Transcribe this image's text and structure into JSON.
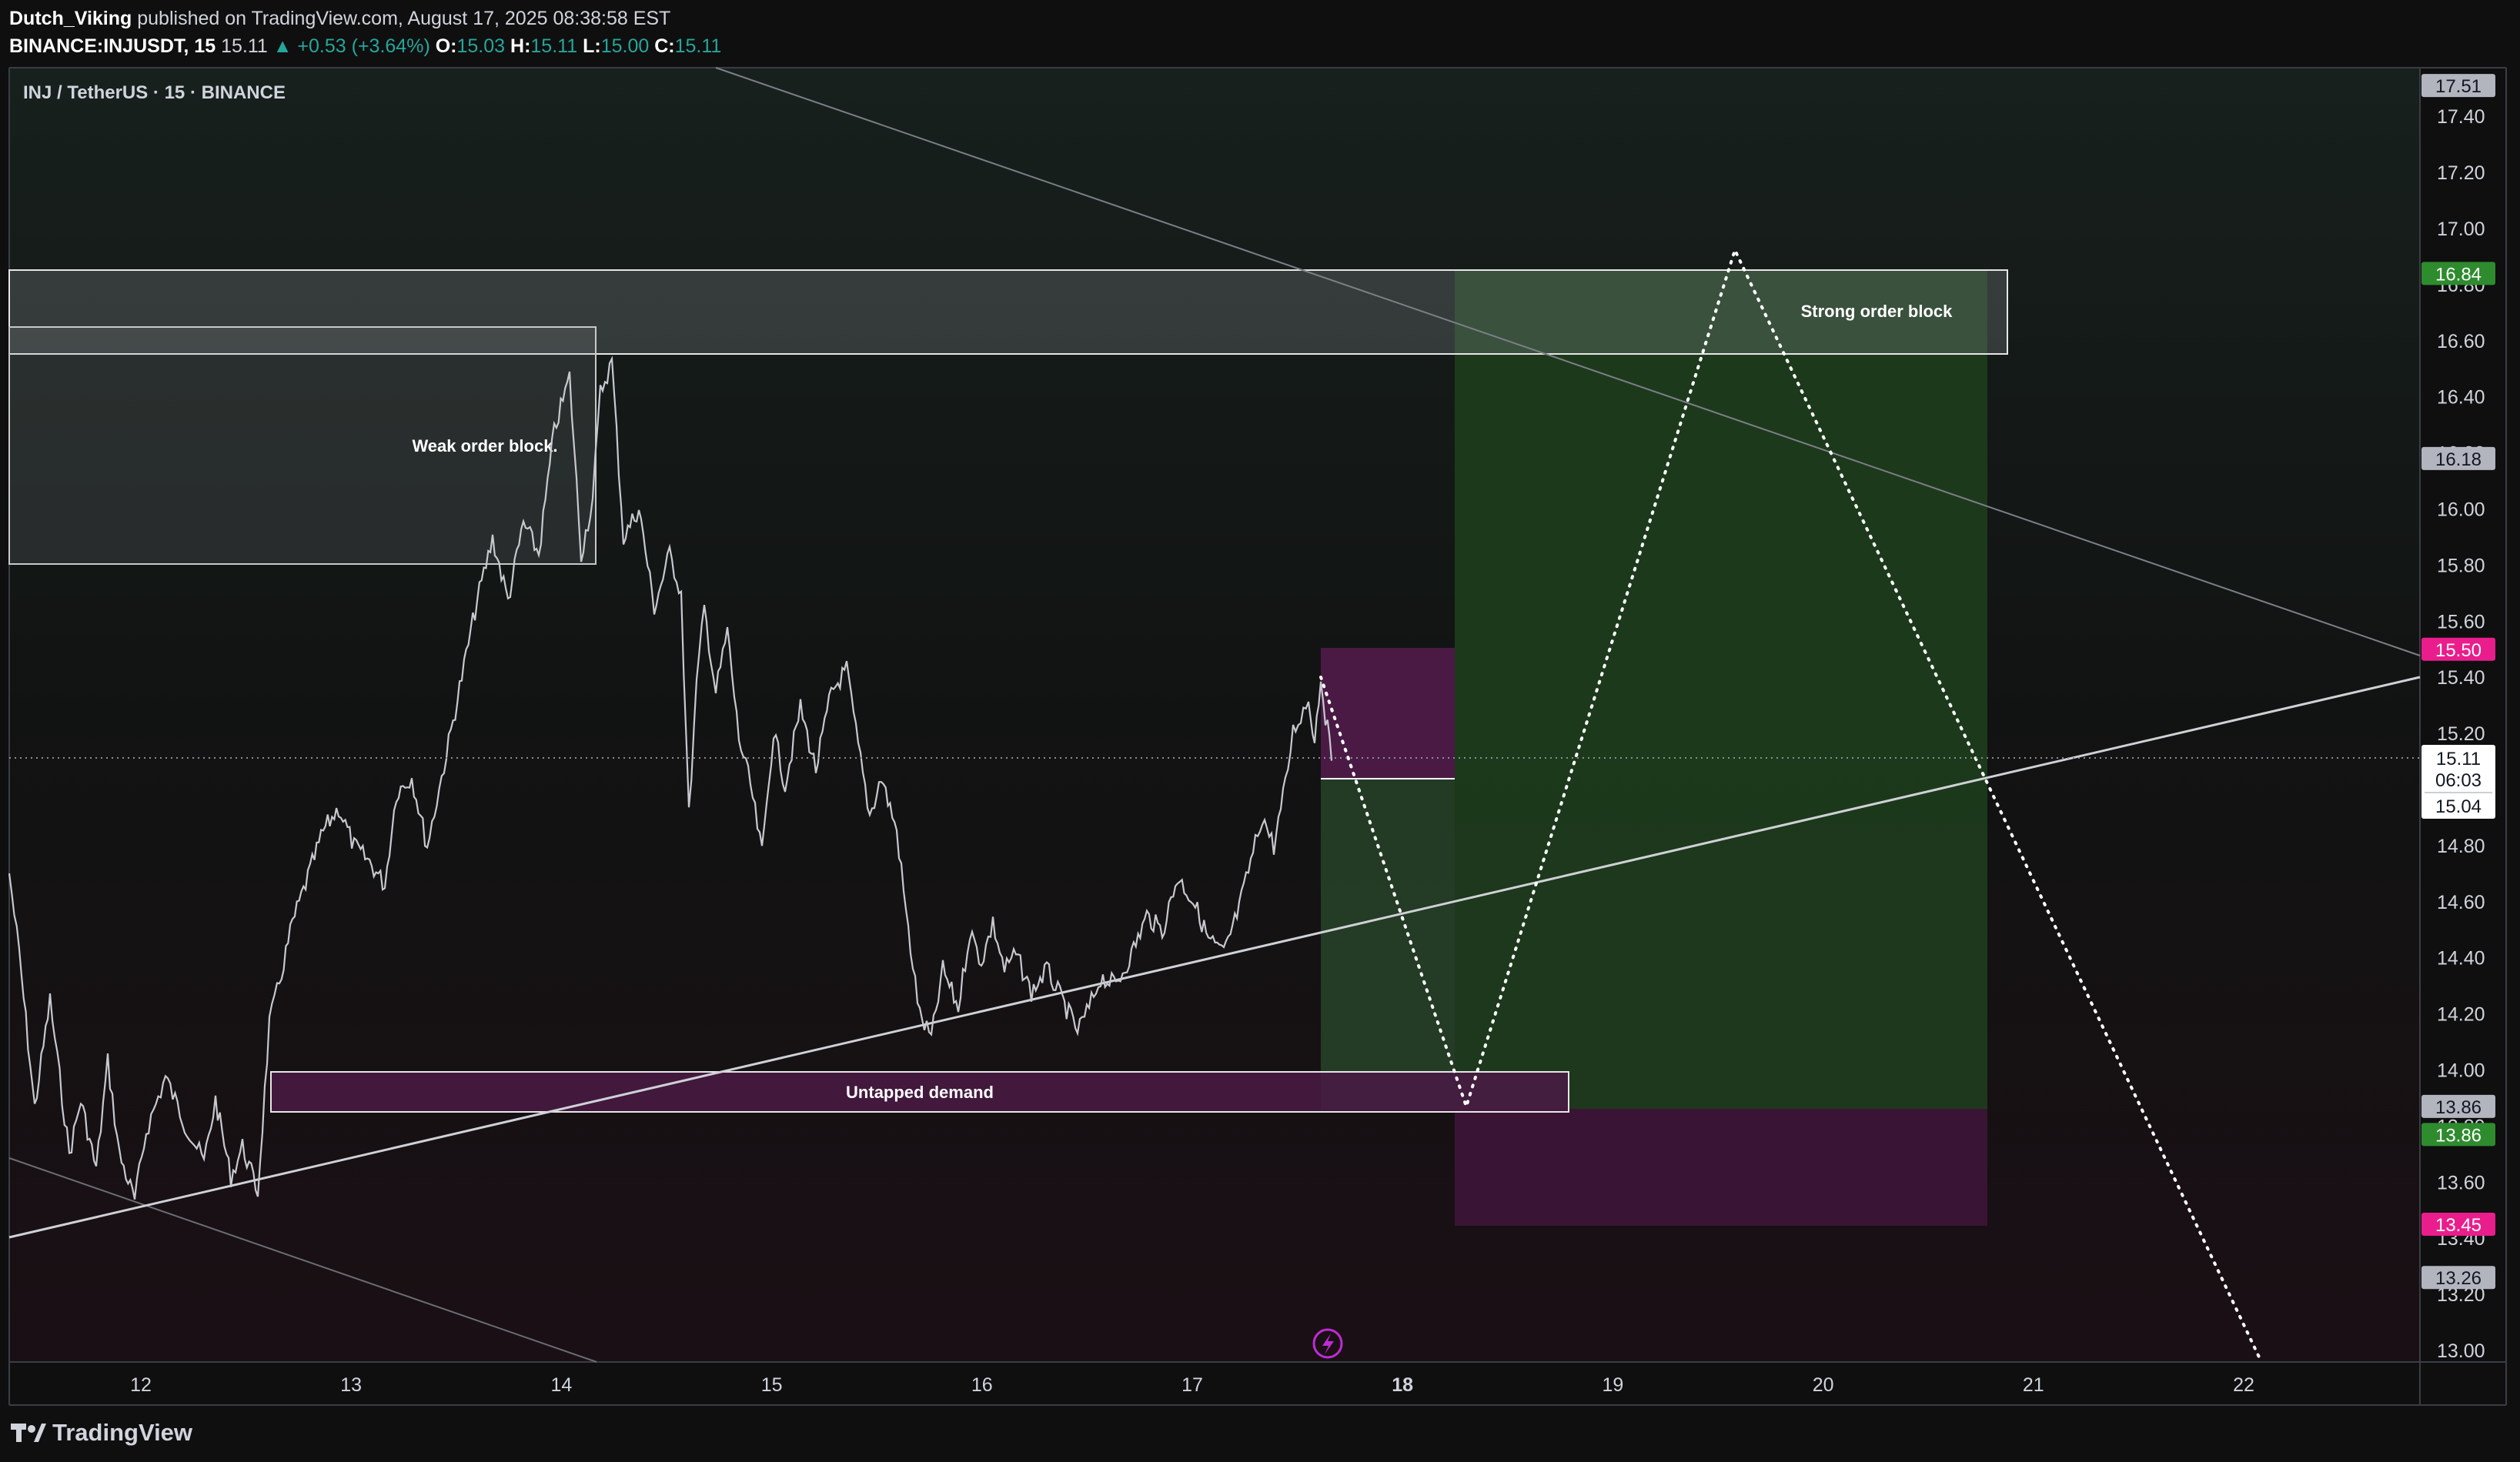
{
  "header": {
    "author": "Dutch_Viking",
    "published_text": "published on TradingView.com, August 17, 2025 08:38:58 EST",
    "symbol": "BINANCE:INJUSDT, 15",
    "last": "15.11",
    "change": "▲ +0.53 (+3.64%)",
    "o_label": "O:",
    "o": "15.03",
    "h_label": "H:",
    "h": "15.11",
    "l_label": "L:",
    "l": "15.00",
    "c_label": "C:",
    "c": "15.11"
  },
  "chart_title": "INJ / TetherUS · 15 · BINANCE",
  "colors": {
    "up": "#26a69a",
    "pink": "#e91e8c",
    "green_tag": "#2e8b2e",
    "grey_tag": "#b2b5be",
    "profit_zone": "#1e3b1c",
    "loss_zone": "#3a1434"
  },
  "price_axis": {
    "min": 13.0,
    "max": 17.6,
    "ticks": [
      "17.40",
      "17.20",
      "17.00",
      "16.80",
      "16.60",
      "16.40",
      "16.20",
      "16.00",
      "15.80",
      "15.60",
      "15.40",
      "15.20",
      "15.00",
      "14.80",
      "14.60",
      "14.40",
      "14.20",
      "14.00",
      "13.80",
      "13.60",
      "13.40",
      "13.20",
      "13.00"
    ],
    "tags": [
      {
        "value": "17.51",
        "price": 17.51,
        "style": "grey"
      },
      {
        "value": "16.84",
        "price": 16.84,
        "style": "green"
      },
      {
        "value": "16.18",
        "price": 16.18,
        "style": "grey"
      },
      {
        "value": "15.50",
        "price": 15.5,
        "style": "pink"
      },
      {
        "value": "13.86",
        "price": 13.87,
        "style": "grey"
      },
      {
        "value": "13.86",
        "price": 13.77,
        "style": "green"
      },
      {
        "value": "13.45",
        "price": 13.45,
        "style": "pink"
      },
      {
        "value": "13.26",
        "price": 13.26,
        "style": "grey"
      }
    ],
    "current": {
      "price": "15.11",
      "countdown": "06:03",
      "low": "15.04"
    }
  },
  "time_axis": {
    "labels": [
      {
        "text": "12",
        "day": 12
      },
      {
        "text": "13",
        "day": 13
      },
      {
        "text": "14",
        "day": 14
      },
      {
        "text": "15",
        "day": 15
      },
      {
        "text": "16",
        "day": 16
      },
      {
        "text": "17",
        "day": 17
      },
      {
        "text": "18",
        "day": 18,
        "bold": true
      },
      {
        "text": "19",
        "day": 19
      },
      {
        "text": "20",
        "day": 20
      },
      {
        "text": "21",
        "day": 21
      },
      {
        "text": "22",
        "day": 22
      }
    ]
  },
  "annotations": {
    "weak_order_block": "Weak order block.",
    "strong_order_block": "Strong order block",
    "untapped_demand": "Untapped demand"
  },
  "footer": {
    "brand": "TradingView"
  }
}
